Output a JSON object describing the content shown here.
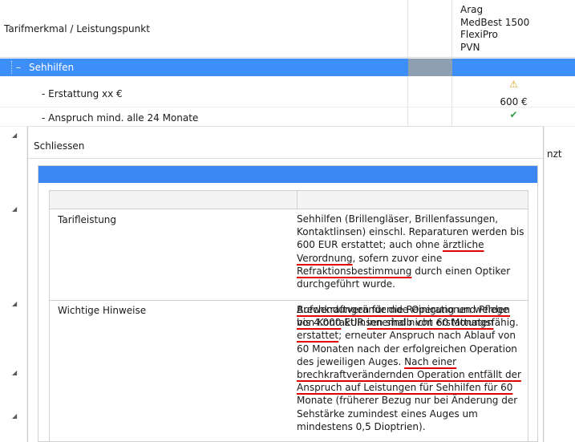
{
  "header": {
    "title": "Tarifmerkmal / Leistungspunkt",
    "column_lines": [
      "Arag",
      "MedBest 1500",
      "FlexiPro",
      "PVN"
    ]
  },
  "group": {
    "toggle": "–",
    "label": "Sehhilfen"
  },
  "rows": [
    {
      "label": "- Erstattung xx €",
      "value": "600 €",
      "icon": "warning-icon"
    },
    {
      "label": "- Anspruch mind. alle 24 Monate",
      "icon": "check-icon"
    }
  ],
  "edge_text": "nzt",
  "modal": {
    "close_label": "Schliessen",
    "table": {
      "rows": [
        {
          "key": "Tarifleistung",
          "paragraphs": [
            [
              {
                "t": "Sehhilfen (Brillengläser, Brillenfassungen, Kontaktlinsen) einschl. Reparaturen werden bis 600 EUR erstattet; auch ohne "
              },
              {
                "t": "ärztliche Verordnung",
                "u": true
              },
              {
                "t": ", sofern zuvor eine "
              },
              {
                "t": "Refraktionsbestimmung",
                "u": true
              },
              {
                "t": " durch einen Optiker durchgeführt wurde."
              }
            ],
            [
              {
                "t": "Aufwendungen für die Reinigung und Pflege von Kontaktlinsen sind nicht erstattungsfähig."
              }
            ]
          ]
        },
        {
          "key": "Wichtige Hinweise",
          "paragraphs": [
            [
              {
                "t": "Brechkraftverändernde Operationen werden bis 4.000",
                "u": true
              },
              {
                "t": " EUR "
              },
              {
                "t": "innerhalb von 60 Monaten erstattet",
                "u": true
              },
              {
                "t": "; erneuter Anspruch nach Ablauf von 60 Monaten nach der erfolgreichen Operation des jeweiligen Auges. "
              },
              {
                "t": "Nach einer brechkraftverändernden Operation entfällt der Anspruch auf Leistungen für Sehhilfen für 60",
                "u": true
              },
              {
                "t": " Monate (früherer Bezug nur bei Änderung der Sehstärke zumindest eines Auges um mindestens 0,5 Dioptrien)."
              }
            ]
          ]
        }
      ]
    }
  },
  "colors": {
    "selection": "#3e8ef7",
    "selection_gray": "#8e9fb2",
    "underline": "#e00000",
    "check": "#2f9e44",
    "warning": "#d7a21a"
  }
}
